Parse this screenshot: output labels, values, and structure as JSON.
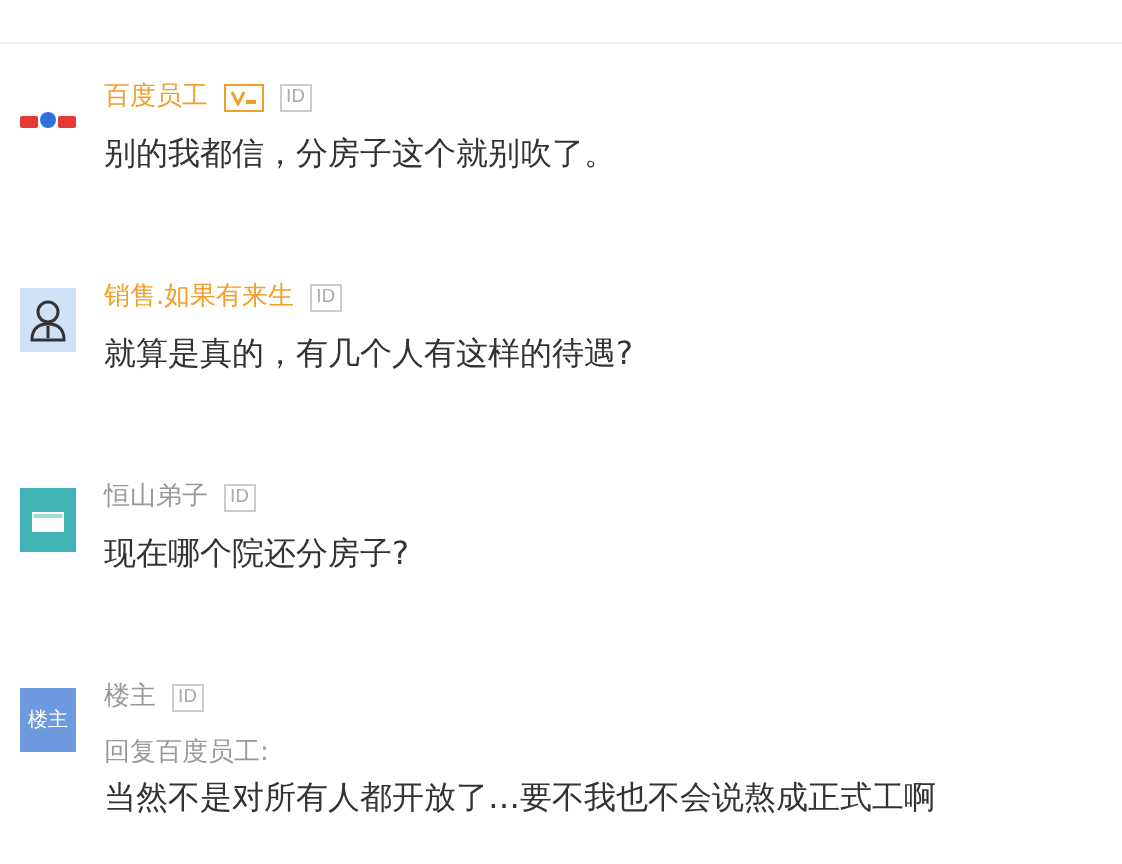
{
  "comments": [
    {
      "avatar": {
        "kind": "logo"
      },
      "name": "百度员工",
      "vip": true,
      "name_highlighted": true,
      "id_badge": "ID",
      "text": "别的我都信，分房子这个就别吹了。"
    },
    {
      "avatar": {
        "kind": "person"
      },
      "name": "销售.如果有来生",
      "vip": false,
      "name_highlighted": true,
      "id_badge": "ID",
      "text": "就算是真的，有几个人有这样的待遇?"
    },
    {
      "avatar": {
        "kind": "cap"
      },
      "name": "恒山弟子",
      "vip": false,
      "name_highlighted": false,
      "id_badge": "ID",
      "text": "现在哪个院还分房子?"
    },
    {
      "avatar": {
        "kind": "label",
        "label": "楼主"
      },
      "name": "楼主",
      "vip": false,
      "name_highlighted": false,
      "id_badge": "ID",
      "reply_to": "回复百度员工:",
      "text": "当然不是对所有人都开放了…要不我也不会说熬成正式工啊"
    }
  ]
}
